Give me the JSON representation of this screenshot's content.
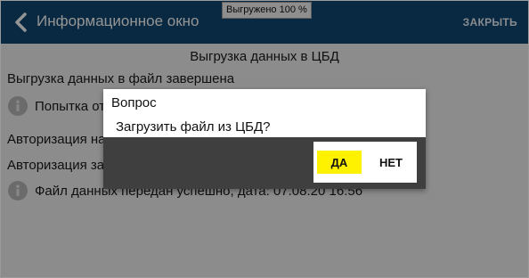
{
  "header": {
    "title": "Информационное окно",
    "close_label": "ЗАКРЫТЬ",
    "progress_badge": "Выгружено 100 %",
    "background_color": "#0f4770"
  },
  "content": {
    "section_title": "Выгрузка данных в ЦБД",
    "lines": [
      {
        "type": "text",
        "text": "Выгрузка данных в файл завершена"
      },
      {
        "type": "item",
        "icon": "info-icon",
        "text": "Попытка от"
      },
      {
        "type": "text",
        "text": "Авторизация на"
      },
      {
        "type": "text",
        "text": "Авторизация за"
      },
      {
        "type": "item",
        "icon": "info-icon",
        "text": "Файл данных передан успешно, дата: 07.08.20 16:56"
      }
    ]
  },
  "dialog": {
    "title": "Вопрос",
    "message": "Загрузить файл из ЦБД?",
    "yes_label": "ДА",
    "no_label": "НЕТ",
    "yes_color": "#fff200"
  }
}
